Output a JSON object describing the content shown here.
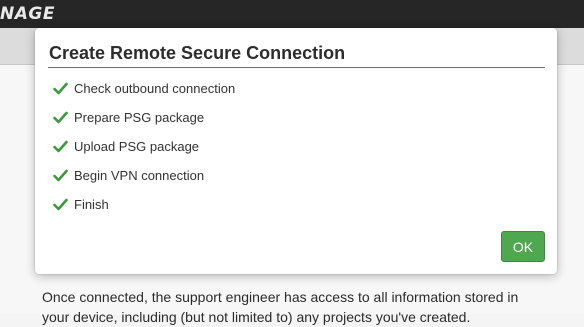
{
  "app": {
    "brand": "NAGE",
    "body_lines": [
      "Once connected, the support engineer has access to all information stored in",
      "your device, including (but not limited to) any projects you've created."
    ]
  },
  "dialog": {
    "title": "Create Remote Secure Connection",
    "steps": [
      {
        "label": "Check outbound connection",
        "icon": "checkmark-icon",
        "status": "done"
      },
      {
        "label": "Prepare PSG package",
        "icon": "checkmark-icon",
        "status": "done"
      },
      {
        "label": "Upload PSG package",
        "icon": "checkmark-icon",
        "status": "done"
      },
      {
        "label": "Begin VPN connection",
        "icon": "checkmark-icon",
        "status": "done"
      },
      {
        "label": "Finish",
        "icon": "checkmark-icon",
        "status": "done"
      }
    ],
    "ok_label": "OK"
  },
  "colors": {
    "check": "#3c9a3c",
    "ok_button": "#4fa84f",
    "header": "#262626"
  }
}
